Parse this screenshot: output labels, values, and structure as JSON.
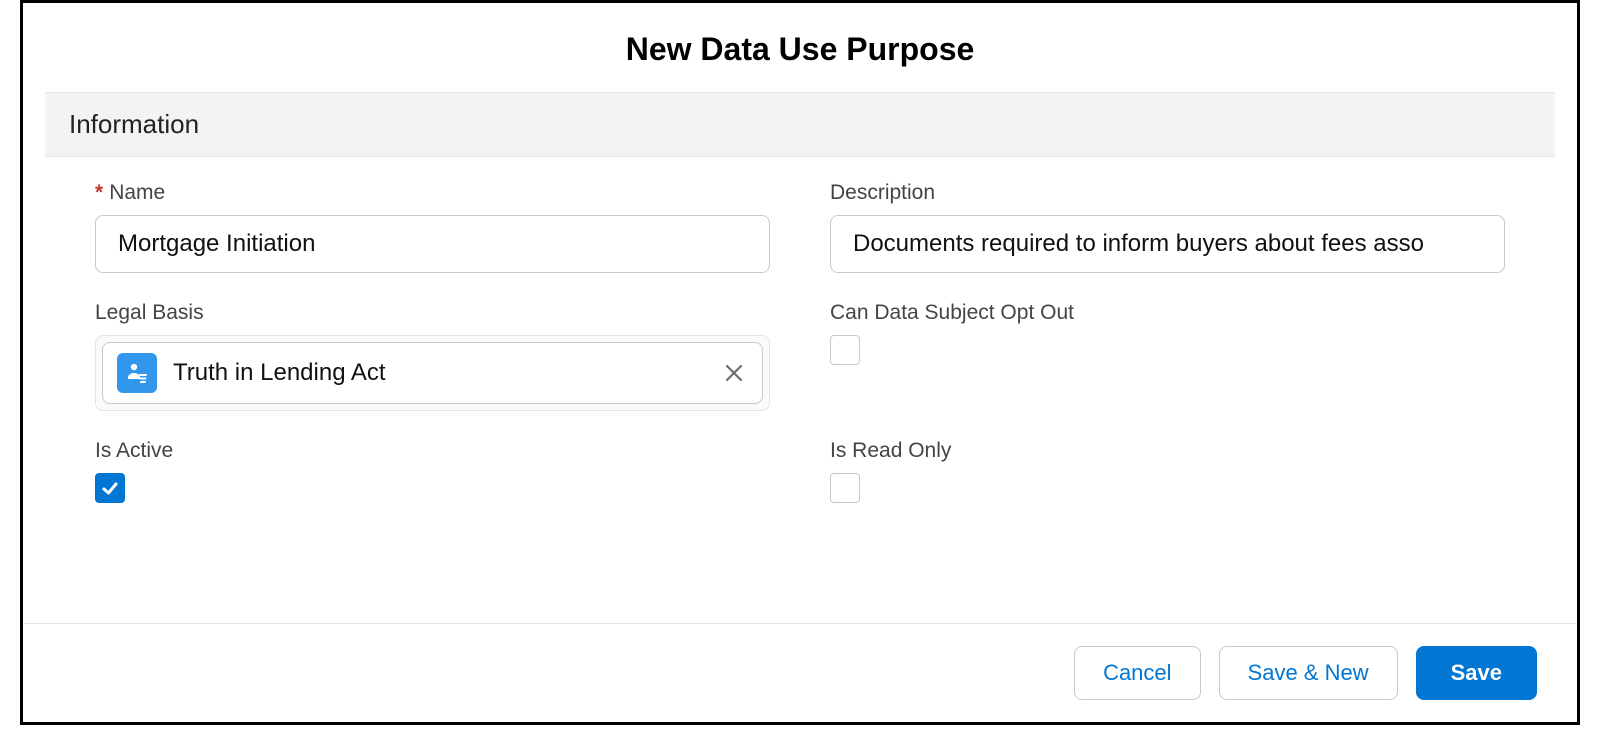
{
  "modal": {
    "title": "New Data Use Purpose",
    "section": "Information"
  },
  "fields": {
    "name": {
      "label": "Name",
      "value": "Mortgage Initiation",
      "required": true
    },
    "description": {
      "label": "Description",
      "value": "Documents required to inform buyers about fees asso"
    },
    "legalBasis": {
      "label": "Legal Basis",
      "selected": "Truth in Lending Act"
    },
    "optOut": {
      "label": "Can Data Subject Opt Out",
      "checked": false
    },
    "isActive": {
      "label": "Is Active",
      "checked": true
    },
    "isReadOnly": {
      "label": "Is Read Only",
      "checked": false
    }
  },
  "footer": {
    "cancel": "Cancel",
    "saveNew": "Save & New",
    "save": "Save"
  }
}
